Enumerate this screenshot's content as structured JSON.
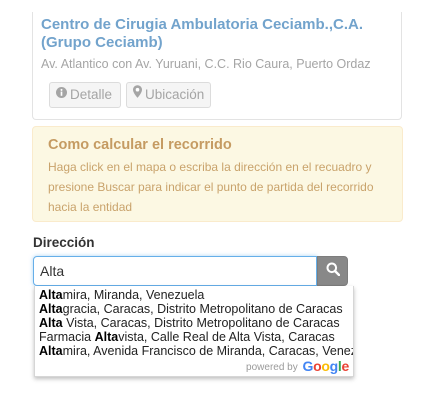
{
  "card": {
    "title": "Centro de Cirugia Ambulatoria Ceciamb.,C.A. (Grupo Ceciamb)",
    "address": "Av. Atlantico con Av. Yuruani, C.C. Rio Caura, Puerto Ordaz",
    "detalle_label": "Detalle",
    "ubicacion_label": "Ubicación",
    "detalle_icon": "info-circle-icon",
    "ubicacion_icon": "map-marker-icon"
  },
  "alert": {
    "title": "Como calcular el recorrido",
    "body": "Haga click en el mapa o escriba la dirección en el recuadro y presione Buscar para indicar el punto de partida del recorrido hacia la entidad"
  },
  "direccion": {
    "label": "Dirección",
    "value": "Alta",
    "search_icon": "search-icon"
  },
  "suggestions": [
    {
      "prefix": "",
      "match": "Alta",
      "rest": "mira, Miranda, Venezuela"
    },
    {
      "prefix": "",
      "match": "Alta",
      "rest": "gracia, Caracas, Distrito Metropolitano de Caracas"
    },
    {
      "prefix": "",
      "match": "Alta",
      "rest": " Vista, Caracas, Distrito Metropolitano de Caracas"
    },
    {
      "prefix": "Farmacia ",
      "match": "Alta",
      "rest": "vista, Calle Real de Alta Vista, Caracas"
    },
    {
      "prefix": "",
      "match": "Alta",
      "rest": "mira, Avenida Francisco de Miranda, Caracas, Venezuela"
    }
  ],
  "powered_by": "powered by",
  "google_logo": "Google",
  "colors": {
    "link_blue": "#72a3cc",
    "alert_bg": "#fcf8e3",
    "alert_text": "#c59b62",
    "search_button": "#888888",
    "focus_border": "#66afe9"
  }
}
